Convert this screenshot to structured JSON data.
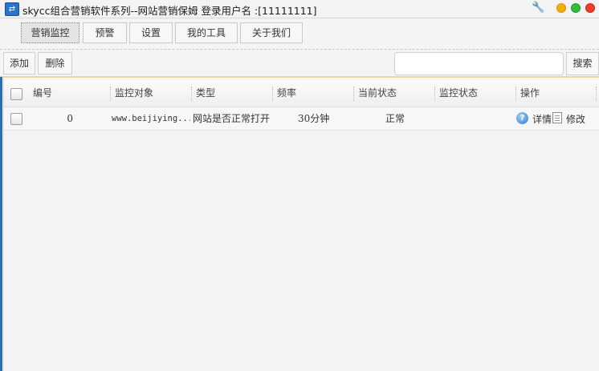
{
  "window": {
    "title": "skycc组合营销软件系列--网站营销保姆 登录用户名 :[11111111]",
    "app_icon": "app-logo-icon",
    "controls": [
      "wrench-icon",
      "minimize-icon",
      "maximize-icon",
      "close-icon"
    ]
  },
  "tabs": [
    {
      "label": "营销监控",
      "active": true
    },
    {
      "label": "预警",
      "active": false
    },
    {
      "label": "设置",
      "active": false
    },
    {
      "label": "我的工具",
      "active": false
    },
    {
      "label": "关于我们",
      "active": false
    }
  ],
  "toolbar": {
    "add_label": "添加",
    "delete_label": "删除",
    "search_value": "",
    "search_label": "搜索"
  },
  "table": {
    "columns": [
      "编号",
      "监控对象",
      "类型",
      "频率",
      "当前状态",
      "监控状态",
      "操作"
    ],
    "rows": [
      {
        "id": "0",
        "target": "www.beijiying...",
        "type": "网站是否正常打开",
        "frequency": "30分钟",
        "current_status": "正常",
        "monitor_status": "",
        "actions": {
          "detail_label": "详情",
          "edit_label": "修改"
        }
      }
    ]
  },
  "colors": {
    "accent_line": "#f2d49a",
    "app_icon": "#2a73c9",
    "close": "#ef3d2e",
    "minimize": "#f4b000",
    "maximize": "#2fbe3a"
  }
}
